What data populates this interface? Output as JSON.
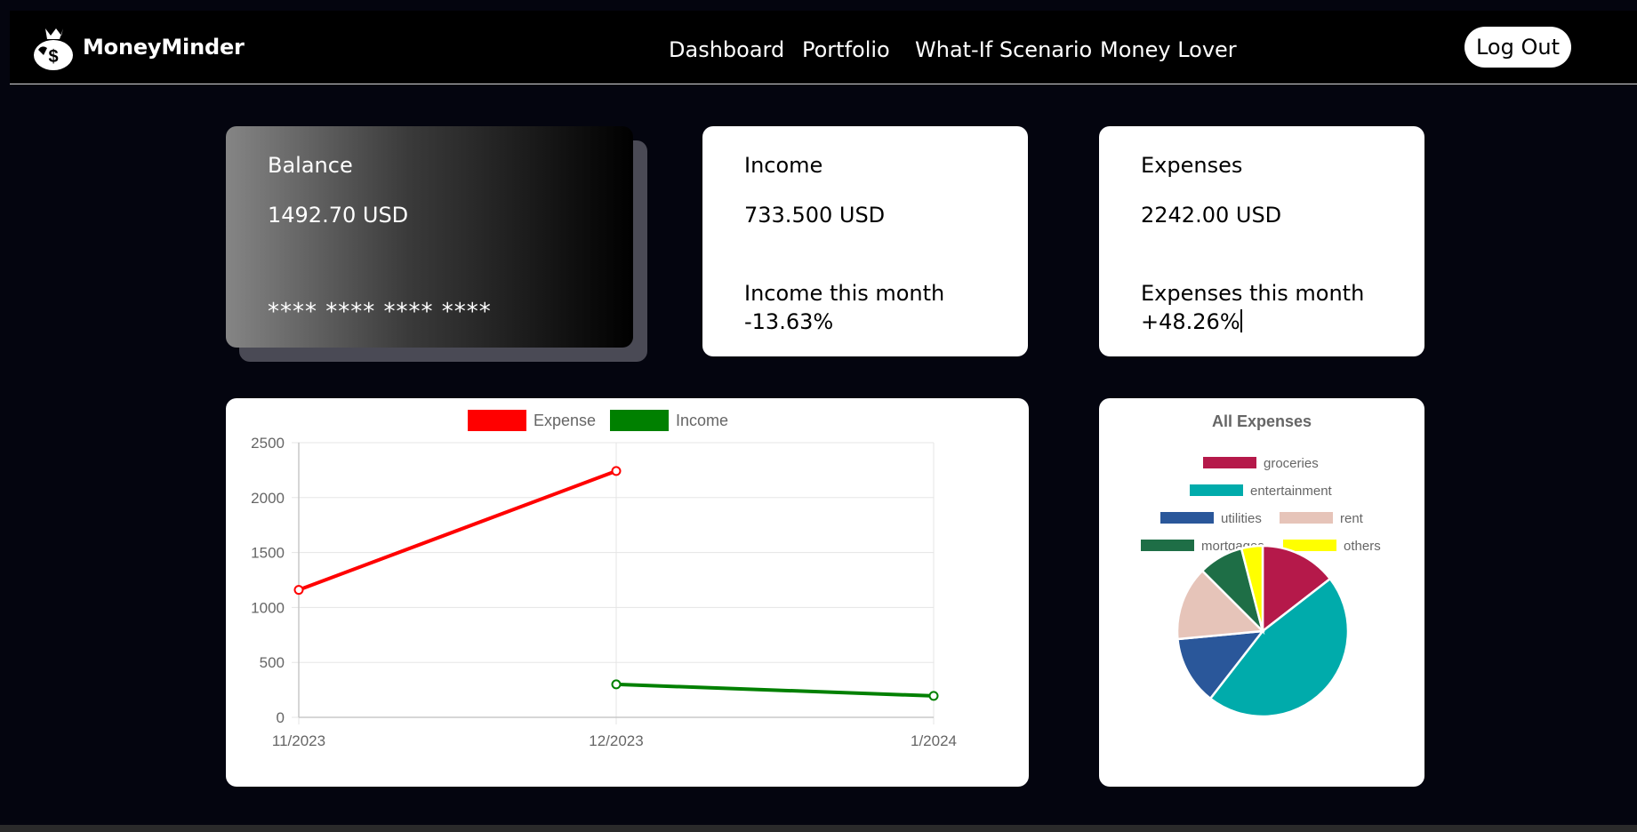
{
  "nav": {
    "brand": "MoneyMinder",
    "links": [
      {
        "label": "Dashboard"
      },
      {
        "label": "Portfolio"
      },
      {
        "label": "What-If Scenario"
      },
      {
        "label": "Money Lover"
      }
    ],
    "logout": "Log Out"
  },
  "balance": {
    "label": "Balance",
    "value": "1492.70 USD",
    "card_number": "**** **** **** ****"
  },
  "income": {
    "label": "Income",
    "value": "733.500 USD",
    "sub_label": "Income this month",
    "change": "-13.63%"
  },
  "expenses": {
    "label": "Expenses",
    "value": "2242.00 USD",
    "sub_label": "Expenses this month",
    "change": "+48.26%"
  },
  "chart_data": [
    {
      "type": "line",
      "x": [
        "11/2023",
        "12/2023",
        "1/2024"
      ],
      "ylim": [
        0,
        2500
      ],
      "yticks": [
        0,
        500,
        1000,
        1500,
        2000,
        2500
      ],
      "grid": true,
      "legend": "top",
      "series": [
        {
          "name": "Expense",
          "color": "#ff0000",
          "values": [
            1160,
            2242,
            null
          ]
        },
        {
          "name": "Income",
          "color": "#008000",
          "values": [
            null,
            300,
            195
          ]
        }
      ]
    },
    {
      "type": "pie",
      "title": "All Expenses",
      "legend": "top",
      "categories": [
        "groceries",
        "entertainment",
        "utilities",
        "rent",
        "mortgages",
        "others"
      ],
      "values": [
        14.5,
        46.0,
        13.0,
        14.0,
        8.5,
        4.0
      ],
      "colors": [
        "#b5194a",
        "#00abab",
        "#2a579a",
        "#e6c4b9",
        "#1e6e46",
        "#ffff00"
      ]
    }
  ]
}
